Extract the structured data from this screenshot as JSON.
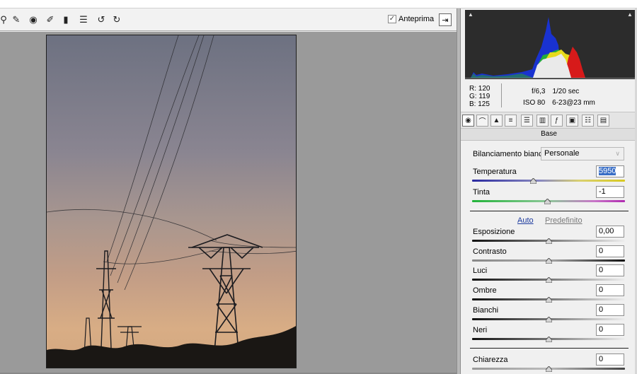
{
  "toolbar": {
    "tools": [
      {
        "name": "adjustment-brush-icon",
        "glyph": "⚲"
      },
      {
        "name": "spot-removal-icon",
        "glyph": "✎"
      },
      {
        "name": "red-eye-icon",
        "glyph": "◉"
      },
      {
        "name": "brush-icon",
        "glyph": "✐"
      },
      {
        "name": "graduated-filter-icon",
        "glyph": "▮"
      },
      {
        "name": "presets-list-icon",
        "glyph": "☰"
      },
      {
        "name": "rotate-left-icon",
        "glyph": "↺"
      },
      {
        "name": "rotate-right-icon",
        "glyph": "↻"
      }
    ],
    "preview_label": "Anteprima",
    "preview_checked": true
  },
  "info": {
    "r": "R:  120",
    "g": "G:  119",
    "b": "B:  125",
    "aperture": "f/6,3",
    "shutter": "1/20 sec",
    "iso": "ISO 80",
    "lens": "6-23@23 mm"
  },
  "panel": {
    "title": "Base",
    "wb_label": "Bilanciamento bianco:",
    "wb_value": "Personale",
    "auto_label": "Auto",
    "default_label": "Predefinito"
  },
  "sliders": {
    "temperatura": {
      "label": "Temperatura",
      "value": "5950",
      "pos": 0.4
    },
    "tinta": {
      "label": "Tinta",
      "value": "-1",
      "pos": 0.49
    },
    "esposizione": {
      "label": "Esposizione",
      "value": "0,00",
      "pos": 0.5
    },
    "contrasto": {
      "label": "Contrasto",
      "value": "0",
      "pos": 0.5
    },
    "luci": {
      "label": "Luci",
      "value": "0",
      "pos": 0.5
    },
    "ombre": {
      "label": "Ombre",
      "value": "0",
      "pos": 0.5
    },
    "bianchi": {
      "label": "Bianchi",
      "value": "0",
      "pos": 0.5
    },
    "neri": {
      "label": "Neri",
      "value": "0",
      "pos": 0.5
    },
    "chiarezza": {
      "label": "Chiarezza",
      "value": "0",
      "pos": 0.5
    }
  },
  "colors": {
    "accent_link": "#1c3a9e",
    "selection": "#3a6fc6",
    "canvas_bg": "#9a9a9a"
  }
}
